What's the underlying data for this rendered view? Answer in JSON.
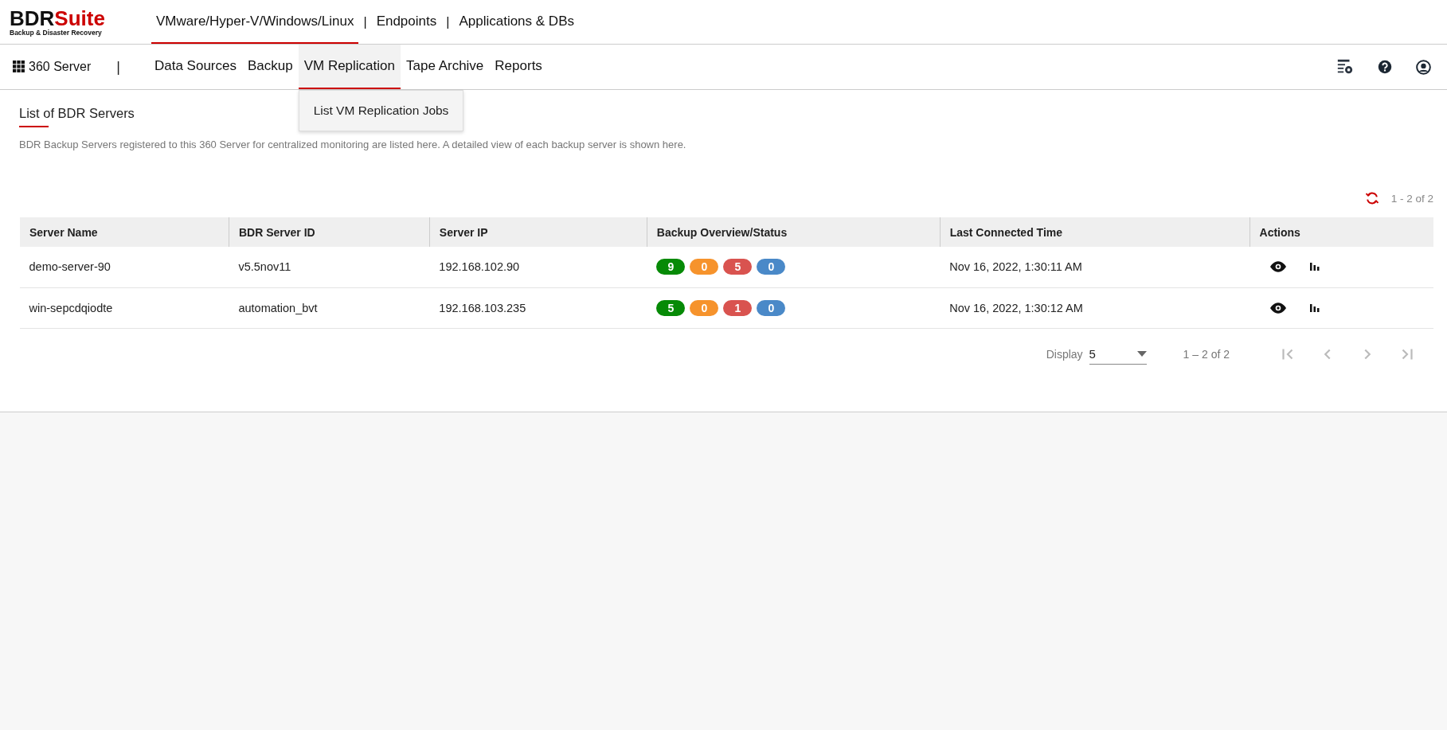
{
  "logo": {
    "brand": "BDR",
    "suite": "Suite",
    "tagline": "Backup & Disaster Recovery"
  },
  "top_nav": [
    {
      "kind": "tab",
      "label": "VMware/Hyper-V/Windows/Linux",
      "selected": true
    },
    {
      "kind": "separator",
      "label": "|"
    },
    {
      "kind": "tab",
      "label": "Endpoints",
      "selected": false
    },
    {
      "kind": "separator",
      "label": "|"
    },
    {
      "kind": "tab",
      "label": "Applications & DBs",
      "selected": false
    }
  ],
  "sub_nav": {
    "home": "360 Server",
    "separator": "|",
    "tabs": [
      {
        "label": "Data Sources",
        "selected": false
      },
      {
        "label": "Backup",
        "selected": false
      },
      {
        "label": "VM Replication",
        "selected": true,
        "expanded": true,
        "menu": [
          "List VM Replication Jobs"
        ]
      },
      {
        "label": "Tape Archive",
        "selected": false
      },
      {
        "label": "Reports",
        "selected": false
      }
    ]
  },
  "page": {
    "title": "List of BDR Servers",
    "description": "BDR Backup Servers registered to this 360 Server for centralized monitoring are listed here. A detailed view of each backup server is shown here.",
    "count": "1 - 2 of 2"
  },
  "table": {
    "columns": [
      "Server Name",
      "BDR Server ID",
      "Server IP",
      "Backup Overview/Status",
      "Last Connected Time",
      "Actions"
    ],
    "rows": [
      {
        "name": "demo-server-90",
        "id": "v5.5nov11",
        "ip": "192.168.102.90",
        "status": [
          {
            "value": "9",
            "color": "#068a06"
          },
          {
            "value": "0",
            "color": "#f6932c"
          },
          {
            "value": "5",
            "color": "#d9534f"
          },
          {
            "value": "0",
            "color": "#4a89c8"
          }
        ],
        "time": "Nov 16, 2022, 1:30:11 AM"
      },
      {
        "name": "win-sepcdqiodte",
        "id": "automation_bvt",
        "ip": "192.168.103.235",
        "status": [
          {
            "value": "5",
            "color": "#068a06"
          },
          {
            "value": "0",
            "color": "#f6932c"
          },
          {
            "value": "1",
            "color": "#d9534f"
          },
          {
            "value": "0",
            "color": "#4a89c8"
          }
        ],
        "time": "Nov 16, 2022, 1:30:12 AM"
      }
    ]
  },
  "pagination": {
    "label": "Display",
    "page_size": "5",
    "range": "1 – 2 of 2",
    "first_disabled": true,
    "prev_disabled": true,
    "next_disabled": true,
    "last_disabled": true
  }
}
